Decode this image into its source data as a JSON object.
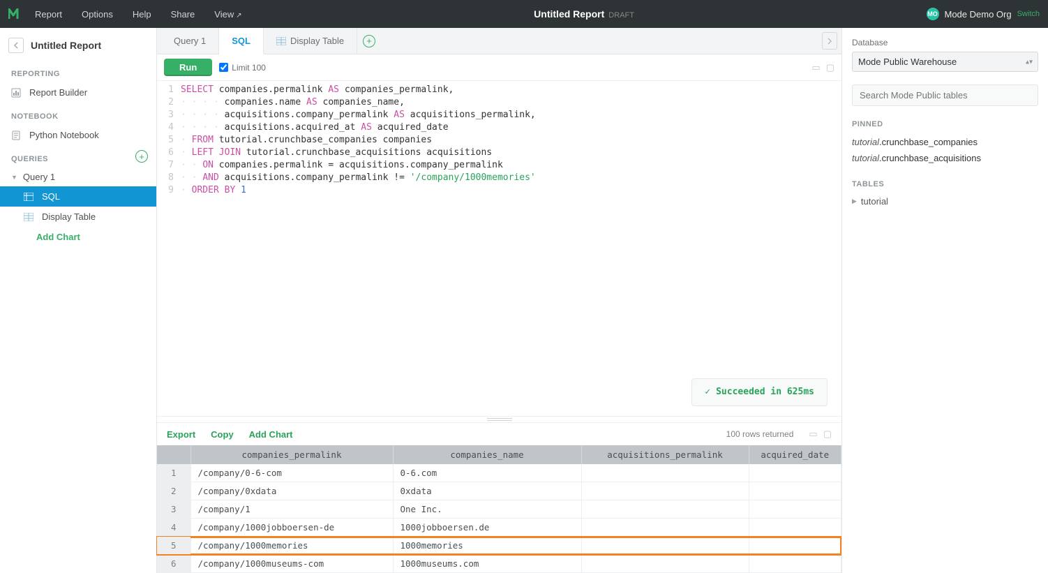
{
  "topbar": {
    "menu": [
      "Report",
      "Options",
      "Help",
      "Share",
      "View"
    ],
    "title": "Untitled Report",
    "status": "DRAFT",
    "org_initials": "MO",
    "org_name": "Mode Demo Org",
    "switch_label": "Switch"
  },
  "sidebar": {
    "report_title": "Untitled Report",
    "sections": {
      "reporting": "REPORTING",
      "notebook": "NOTEBOOK",
      "queries": "QUERIES"
    },
    "report_builder": "Report Builder",
    "python_notebook": "Python Notebook",
    "query1": "Query 1",
    "sql": "SQL",
    "display_table": "Display Table",
    "add_chart": "Add Chart"
  },
  "tabs": {
    "query1": "Query 1",
    "sql": "SQL",
    "display_table": "Display Table"
  },
  "toolbar": {
    "run_label": "Run",
    "limit_label": "Limit 100"
  },
  "code": {
    "lines": [
      "SELECT companies.permalink AS companies_permalink,",
      "       companies.name AS companies_name,",
      "       acquisitions.company_permalink AS acquisitions_permalink,",
      "       acquisitions.acquired_at AS acquired_date",
      "  FROM tutorial.crunchbase_companies companies",
      "  LEFT JOIN tutorial.crunchbase_acquisitions acquisitions",
      "    ON companies.permalink = acquisitions.company_permalink",
      "   AND acquisitions.company_permalink != '/company/1000memories'",
      " ORDER BY 1"
    ]
  },
  "status_toast": "Succeeded in 625ms",
  "results_toolbar": {
    "export": "Export",
    "copy": "Copy",
    "add_chart": "Add Chart",
    "rows_returned": "100 rows returned"
  },
  "results": {
    "columns": [
      "companies_permalink",
      "companies_name",
      "acquisitions_permalink",
      "acquired_date"
    ],
    "rows": [
      {
        "idx": 1,
        "cells": [
          "/company/0-6-com",
          "0-6.com",
          "",
          ""
        ]
      },
      {
        "idx": 2,
        "cells": [
          "/company/0xdata",
          "0xdata",
          "",
          ""
        ]
      },
      {
        "idx": 3,
        "cells": [
          "/company/1",
          "One Inc.",
          "",
          ""
        ]
      },
      {
        "idx": 4,
        "cells": [
          "/company/1000jobboersen-de",
          "1000jobboersen.de",
          "",
          ""
        ]
      },
      {
        "idx": 5,
        "cells": [
          "/company/1000memories",
          "1000memories",
          "",
          ""
        ],
        "highlight": true
      },
      {
        "idx": 6,
        "cells": [
          "/company/1000museums-com",
          "1000museums.com",
          "",
          ""
        ]
      }
    ]
  },
  "right_panel": {
    "database_label": "Database",
    "database_selected": "Mode Public Warehouse",
    "search_placeholder": "Search Mode Public tables",
    "pinned_label": "PINNED",
    "pinned": [
      {
        "prefix": "tutorial",
        "name": ".crunchbase_companies"
      },
      {
        "prefix": "tutorial",
        "name": ".crunchbase_acquisitions"
      }
    ],
    "tables_label": "TABLES",
    "tree_root": "tutorial"
  }
}
